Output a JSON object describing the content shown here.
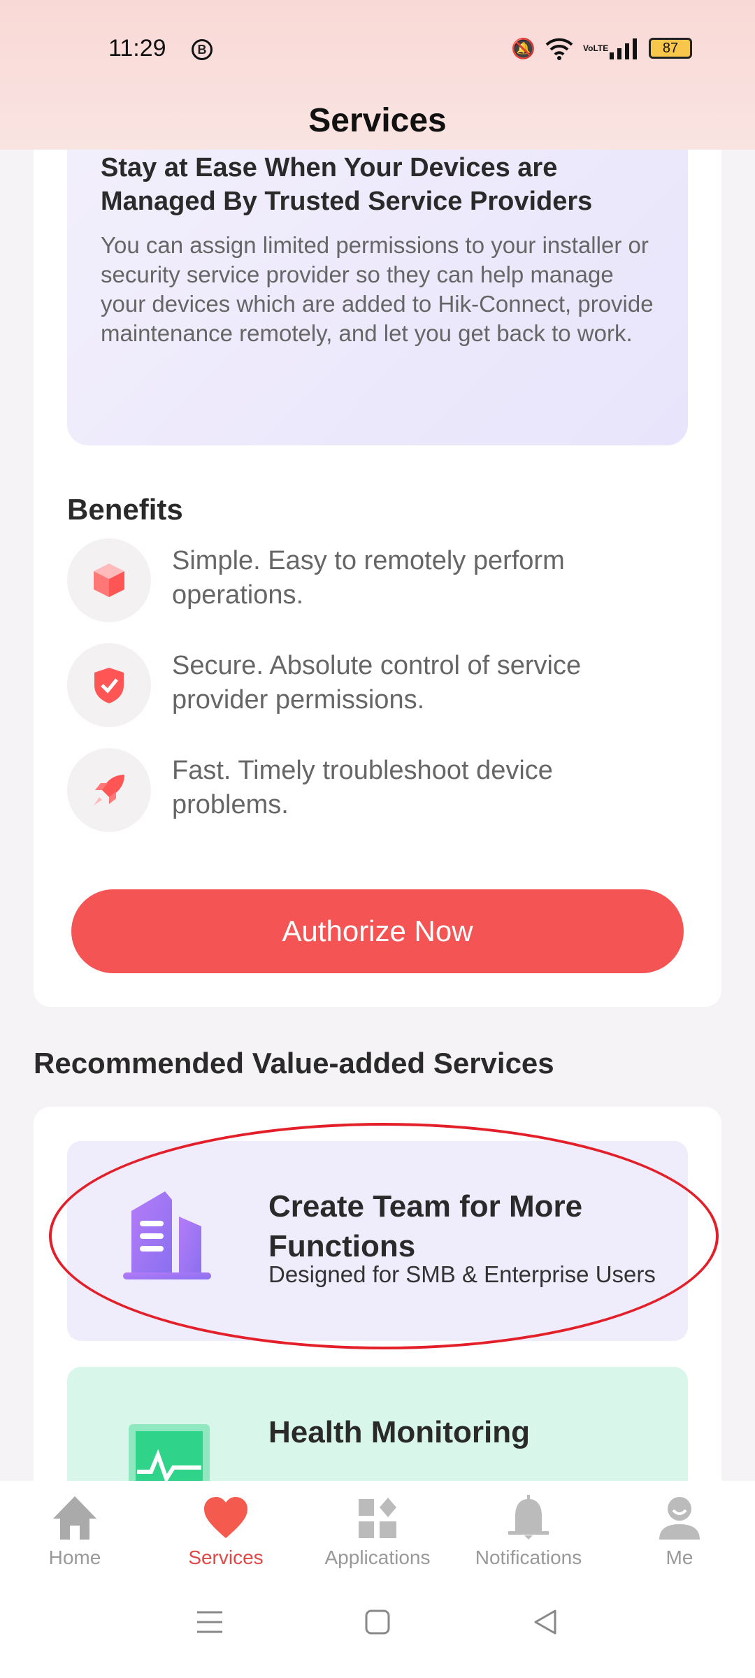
{
  "status": {
    "time": "11:29",
    "badge": "B",
    "battery": "87",
    "network": "VoLTE"
  },
  "header": {
    "title": "Services"
  },
  "banner": {
    "title_cut": "Stay at Ease When Your Devices are",
    "title": "Managed By Trusted Service Providers",
    "body": "You can assign limited permissions to your installer or security service provider so they can help manage your devices which are added to Hik-Connect, provide maintenance remotely, and let you get back to work."
  },
  "benefits": {
    "heading": "Benefits",
    "items": [
      {
        "icon": "cube-icon",
        "text": "Simple. Easy to remotely perform operations."
      },
      {
        "icon": "shield-check-icon",
        "text": "Secure. Absolute control of service provider permissions."
      },
      {
        "icon": "rocket-icon",
        "text": "Fast. Timely troubleshoot device problems."
      }
    ]
  },
  "authorize_label": "Authorize Now",
  "recommended": {
    "heading": "Recommended Value-added Services",
    "items": [
      {
        "icon": "building-icon",
        "title": "Create Team for More Functions",
        "subtitle": "Designed for SMB & Enterprise Users",
        "color": "#efecfc"
      },
      {
        "icon": "health-monitor-icon",
        "title": "Health Monitoring",
        "color": "#d9f6ea"
      }
    ]
  },
  "nav": {
    "items": [
      {
        "label": "Home",
        "icon": "home-icon"
      },
      {
        "label": "Services",
        "icon": "heart-icon",
        "active": true
      },
      {
        "label": "Applications",
        "icon": "applications-icon"
      },
      {
        "label": "Notifications",
        "icon": "bell-icon"
      },
      {
        "label": "Me",
        "icon": "person-icon"
      }
    ]
  },
  "colors": {
    "accent": "#f55454",
    "highlight": "#e3202a"
  }
}
